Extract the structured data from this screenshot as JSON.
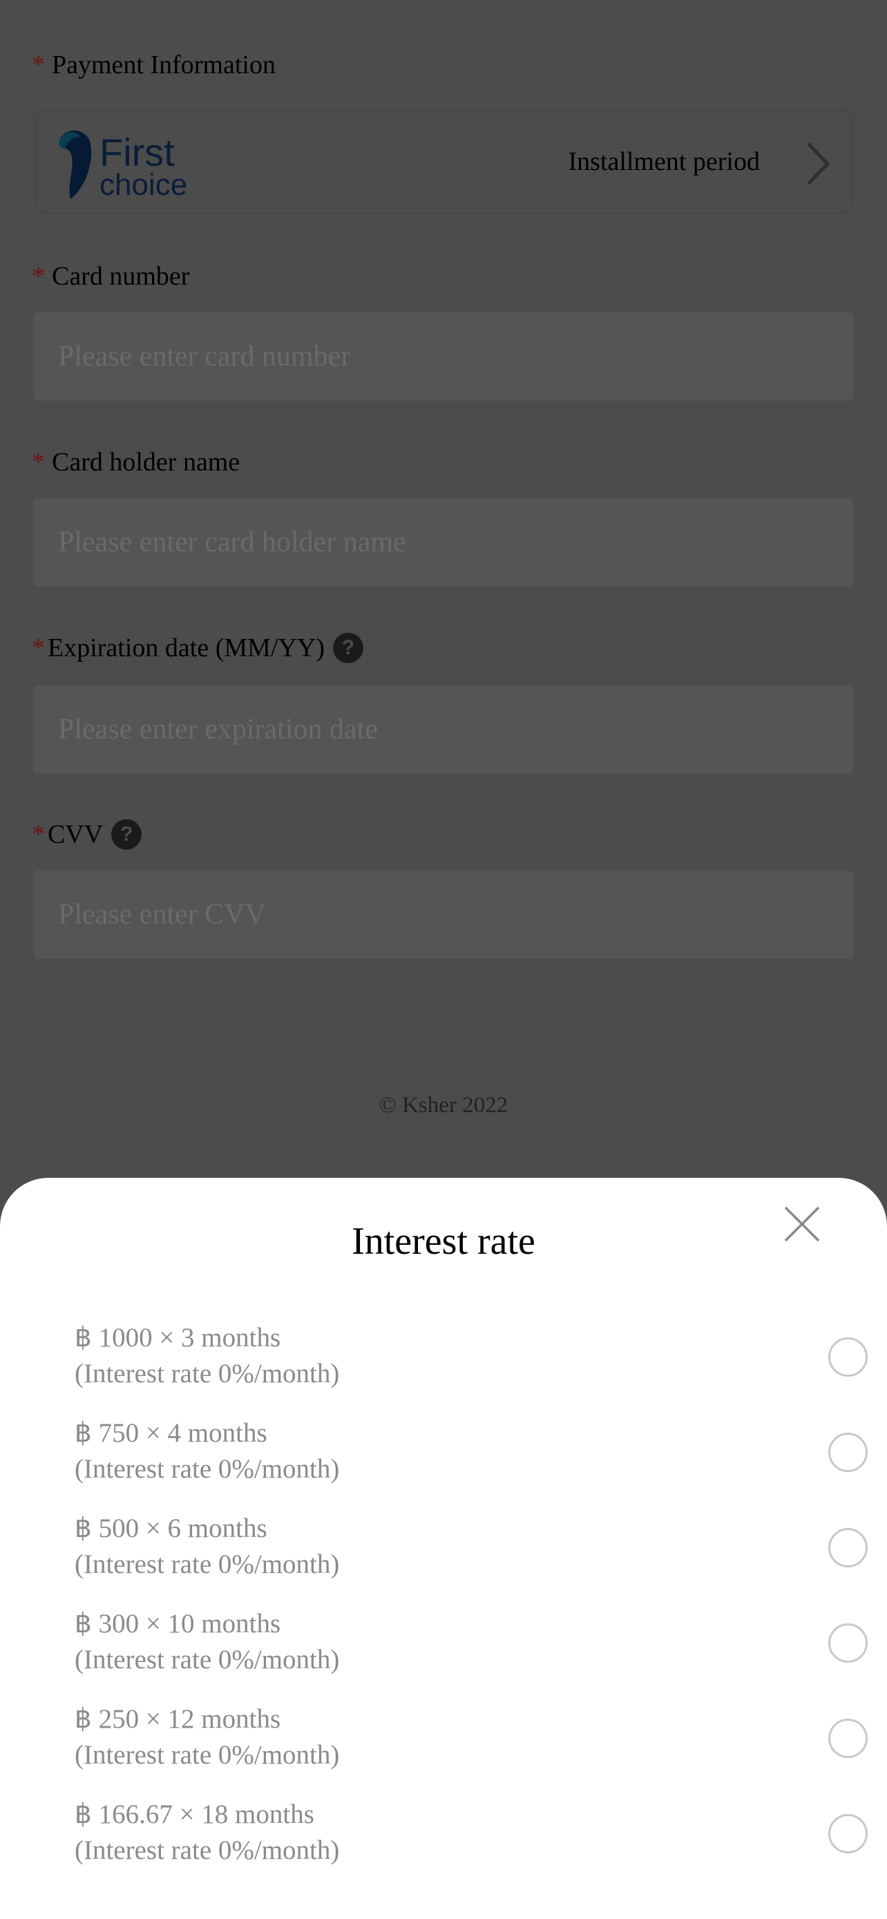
{
  "form": {
    "payment_label": "Payment Information",
    "card_brand": "First choice",
    "installment_label": "Installment period",
    "card_number_label": "Card number",
    "card_number_placeholder": "Please enter card number",
    "holder_label": "Card holder name",
    "holder_placeholder": "Please enter card holder name",
    "expiry_label": "Expiration date (MM/YY)",
    "expiry_placeholder": "Please enter expiration date",
    "cvv_label": "CVV",
    "cvv_placeholder": "Please enter CVV",
    "required_mark": "*",
    "help_glyph": "?",
    "footer": "© Ksher 2022"
  },
  "sheet": {
    "title": "Interest rate",
    "options": [
      {
        "amount": "฿ 1000 × 3 months",
        "rate": "(Interest rate 0%/month)",
        "selected": false
      },
      {
        "amount": "฿ 750 × 4 months",
        "rate": "(Interest rate 0%/month)",
        "selected": false
      },
      {
        "amount": "฿ 500 × 6 months",
        "rate": "(Interest rate 0%/month)",
        "selected": false
      },
      {
        "amount": "฿ 300 × 10 months",
        "rate": "(Interest rate 0%/month)",
        "selected": false
      },
      {
        "amount": "฿ 250 × 12 months",
        "rate": "(Interest rate 0%/month)",
        "selected": false
      },
      {
        "amount": "฿ 166.67 × 18 months",
        "rate": "(Interest rate 0%/month)",
        "selected": false
      }
    ]
  },
  "colors": {
    "required": "#e02020",
    "brand": "#0d2a55",
    "overlay": "rgba(0,0,0,0.7)"
  }
}
